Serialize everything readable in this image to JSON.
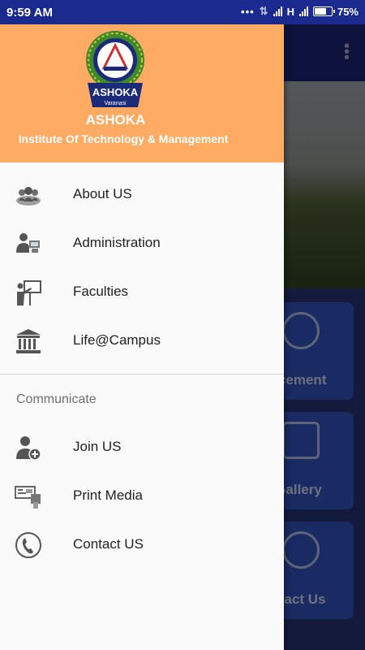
{
  "status_bar": {
    "time": "9:59 AM",
    "network": "H",
    "battery": "75%",
    "battery_level": 0.75
  },
  "drawer": {
    "brand": "ASHOKA",
    "institute": "Institute Of Technology & Management",
    "logo_text": {
      "top": "ASHOKA",
      "sub": "Varanasi"
    },
    "menu": [
      {
        "label": "About US",
        "icon": "group-icon"
      },
      {
        "label": "Administration",
        "icon": "admin-computer-icon"
      },
      {
        "label": "Faculties",
        "icon": "teacher-board-icon"
      },
      {
        "label": "Life@Campus",
        "icon": "institution-building-icon"
      }
    ],
    "section_title": "Communicate",
    "communicate": [
      {
        "label": "Join US",
        "icon": "add-user-icon"
      },
      {
        "label": "Print Media",
        "icon": "print-media-icon"
      },
      {
        "label": "Contact US",
        "icon": "phone-icon"
      }
    ]
  },
  "background": {
    "cards": [
      "acement",
      "Gallery",
      "ntact Us"
    ]
  },
  "colors": {
    "status_bar": "#1a2a8e",
    "drawer_header": "#ffab63",
    "drawer_bg": "#fafafa"
  }
}
